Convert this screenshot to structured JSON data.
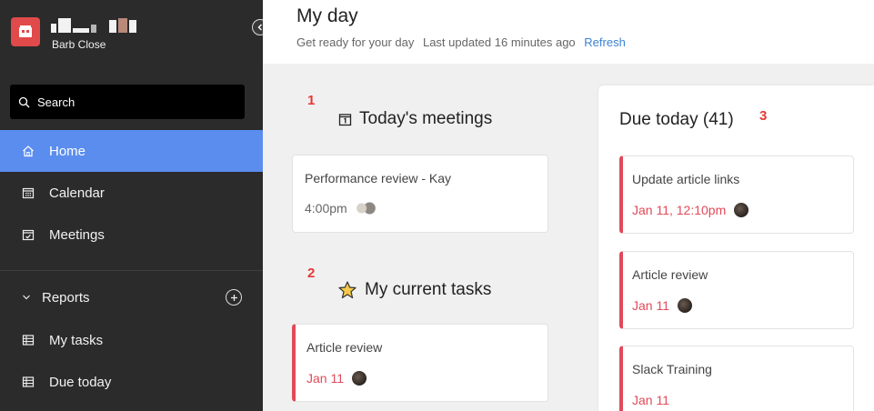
{
  "sidebar": {
    "workspace_user": "Barb Close",
    "search_label": "Search",
    "nav": [
      {
        "label": "Home",
        "icon": "home-icon",
        "active": true
      },
      {
        "label": "Calendar",
        "icon": "calendar-icon",
        "active": false
      },
      {
        "label": "Meetings",
        "icon": "meetings-icon",
        "active": false
      }
    ],
    "reports_label": "Reports",
    "reports_items": [
      {
        "label": "My tasks",
        "icon": "table-icon"
      },
      {
        "label": "Due today",
        "icon": "table-icon"
      }
    ],
    "colors": {
      "background": "#2b2b2b",
      "active": "#5b8def",
      "logo": "#e04a4a"
    }
  },
  "header": {
    "title": "My day",
    "subtitle": "Get ready for your day",
    "last_updated": "Last updated 16 minutes ago",
    "refresh_label": "Refresh"
  },
  "meetings": {
    "marker": "1",
    "title": "Today's meetings",
    "icon": "calendar-day-icon",
    "items": [
      {
        "title": "Performance review - Kay",
        "time": "4:00pm"
      }
    ]
  },
  "current_tasks": {
    "marker": "2",
    "title": "My current tasks",
    "icon": "star-icon",
    "items": [
      {
        "title": "Article review",
        "date": "Jan 11"
      }
    ]
  },
  "due_today": {
    "marker": "3",
    "title": "Due today (41)",
    "items": [
      {
        "title": "Update article links",
        "date": "Jan 11, 12:10pm"
      },
      {
        "title": "Article review",
        "date": "Jan 11"
      },
      {
        "title": "Slack Training",
        "date": "Jan 11"
      }
    ]
  },
  "accent_color": "#e04a5a"
}
